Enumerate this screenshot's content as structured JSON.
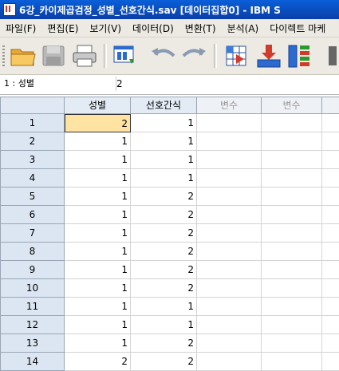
{
  "window": {
    "title": "6강_카이제곱검정_성별_선호간식.sav [데이터집합0] - IBM S"
  },
  "menu": [
    "파일(F)",
    "편집(E)",
    "보기(V)",
    "데이터(D)",
    "변환(T)",
    "분석(A)",
    "다이렉트 마케"
  ],
  "cellbar": {
    "ref": "1 : 성별",
    "value": "2"
  },
  "columns": [
    "성별",
    "선호간식",
    "변수",
    "변수",
    ""
  ],
  "rows": [
    {
      "n": "1",
      "v": [
        "2",
        "1"
      ]
    },
    {
      "n": "2",
      "v": [
        "1",
        "1"
      ]
    },
    {
      "n": "3",
      "v": [
        "1",
        "1"
      ]
    },
    {
      "n": "4",
      "v": [
        "1",
        "1"
      ]
    },
    {
      "n": "5",
      "v": [
        "1",
        "2"
      ]
    },
    {
      "n": "6",
      "v": [
        "1",
        "2"
      ]
    },
    {
      "n": "7",
      "v": [
        "1",
        "2"
      ]
    },
    {
      "n": "8",
      "v": [
        "1",
        "2"
      ]
    },
    {
      "n": "9",
      "v": [
        "1",
        "2"
      ]
    },
    {
      "n": "10",
      "v": [
        "1",
        "2"
      ]
    },
    {
      "n": "11",
      "v": [
        "1",
        "1"
      ]
    },
    {
      "n": "12",
      "v": [
        "1",
        "1"
      ]
    },
    {
      "n": "13",
      "v": [
        "1",
        "2"
      ]
    },
    {
      "n": "14",
      "v": [
        "2",
        "2"
      ]
    }
  ]
}
